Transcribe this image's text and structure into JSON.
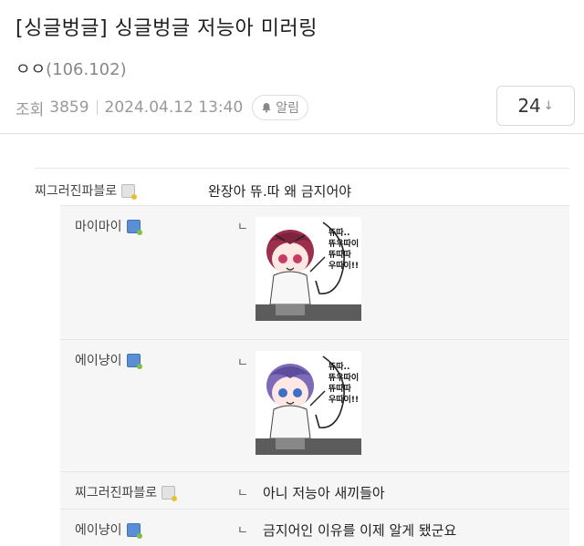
{
  "post": {
    "title": "[싱글벙글] 싱글벙글 저능아 미러링",
    "author": "ㅇㅇ",
    "ip": "(106.102)",
    "views_label": "조회",
    "views": "3859",
    "date": "2024.04.12 13:40",
    "alarm_label": "알림",
    "comment_count": "24"
  },
  "comments": [
    {
      "nick": "찌그러진파블로",
      "text": "완장아 뜌.따 왜 금지어야"
    },
    {
      "nick": "마이마이",
      "sticker_text": [
        "뜌따..",
        "뜌우따이",
        "뜌따따",
        "우따이!!"
      ]
    },
    {
      "nick": "에이냥이",
      "sticker_text": [
        "뜌따..",
        "뜌우따이",
        "뜌따따",
        "우따이!!"
      ]
    },
    {
      "nick": "찌그러진파블로",
      "text": "아니 저능아 새끼들아"
    },
    {
      "nick": "에이냥이",
      "text": "금지어인 이유를 이제 알게 됐군요"
    }
  ],
  "icons": {
    "reply_marker": "ㄴ",
    "bell": "bell-icon",
    "sort_arrow": "↓"
  }
}
